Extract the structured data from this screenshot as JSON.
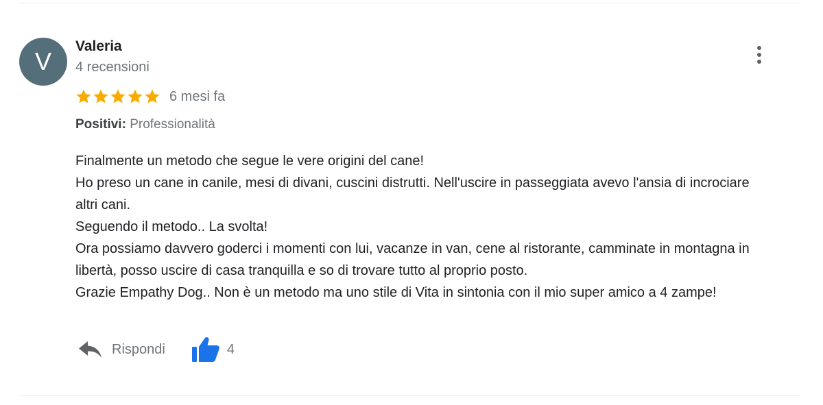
{
  "review": {
    "author": {
      "initial": "V",
      "name": "Valeria",
      "reviews_count": "4 recensioni",
      "avatar_color": "#546e7a"
    },
    "rating": {
      "stars": 5,
      "max": 5,
      "star_color": "#f9ab00"
    },
    "date": "6 mesi fa",
    "positives": {
      "label": "Positivi:",
      "value": "Professionalità"
    },
    "text": [
      "Finalmente un metodo che segue le vere origini del cane!",
      "Ho preso un cane in canile, mesi di divani, cuscini distrutti. Nell'uscire in passeggiata avevo l'ansia di incrociare altri cani.",
      "Seguendo il metodo.. La svolta!",
      "Ora possiamo davvero goderci i momenti con lui, vacanze in van, cene al ristorante, camminate in montagna in libertà, posso uscire di casa tranquilla e so di trovare tutto al proprio posto.",
      "Grazie Empathy Dog.. Non è un metodo ma uno stile di Vita in sintonia con il mio super amico a 4 zampe!"
    ],
    "actions": {
      "reply_label": "Rispondi",
      "reply_icon": "reply-icon",
      "like_icon": "thumbs-up-icon",
      "like_count": "4",
      "like_color": "#1a73e8"
    },
    "menu_icon": "more-vert-icon"
  }
}
